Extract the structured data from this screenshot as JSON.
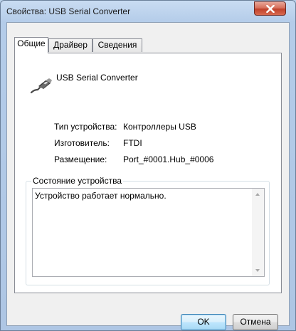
{
  "window": {
    "title": "Свойства: USB Serial Converter"
  },
  "tabs": [
    {
      "label": "Общие",
      "active": true
    },
    {
      "label": "Драйвер",
      "active": false
    },
    {
      "label": "Сведения",
      "active": false
    }
  ],
  "device": {
    "name": "USB Serial Converter",
    "icon": "usb-connector-icon"
  },
  "properties": [
    {
      "label": "Тип устройства:",
      "value": "Контроллеры USB"
    },
    {
      "label": "Изготовитель:",
      "value": "FTDI"
    },
    {
      "label": "Размещение:",
      "value": "Port_#0001.Hub_#0006"
    }
  ],
  "status": {
    "group_label": "Состояние устройства",
    "text": "Устройство работает нормально."
  },
  "buttons": {
    "ok": "OK",
    "cancel": "Отмена"
  },
  "colors": {
    "close_button": "#c0422c",
    "default_button_border": "#3c7fb1"
  }
}
